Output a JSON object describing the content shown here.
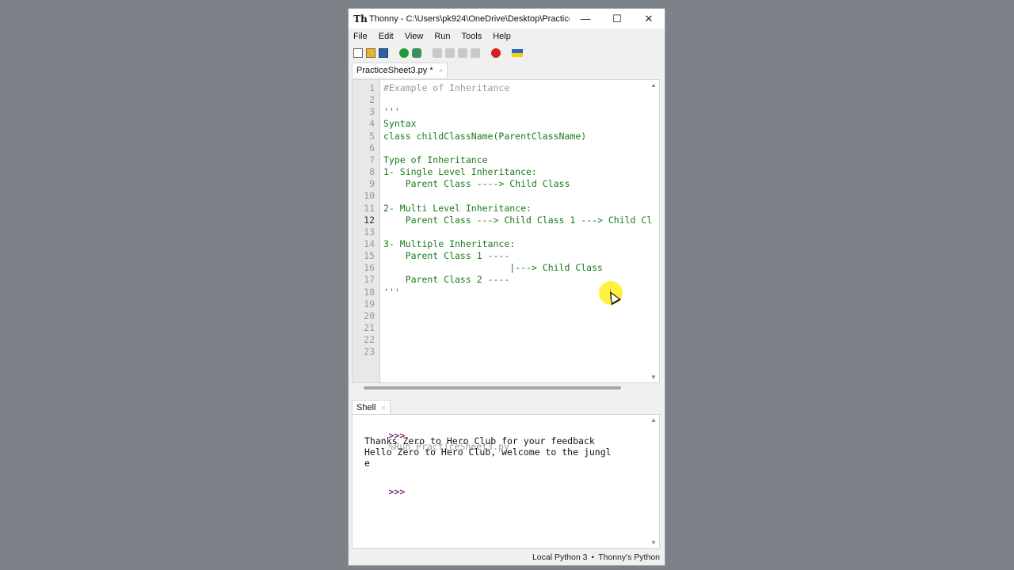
{
  "window": {
    "app_icon": "Th",
    "title": "Thonny  -  C:\\Users\\pk924\\OneDrive\\Desktop\\Practice...",
    "minimize": "—",
    "maximize": "☐",
    "close": "✕"
  },
  "menu": [
    "File",
    "Edit",
    "View",
    "Run",
    "Tools",
    "Help"
  ],
  "toolbar_icons": [
    "new-file-icon",
    "open-file-icon",
    "save-icon",
    "run-icon",
    "debug-icon",
    "step-over-icon",
    "step-into-icon",
    "step-out-icon",
    "resume-icon",
    "stop-icon",
    "ukraine-flag-icon"
  ],
  "editor": {
    "tab_label": "PracticeSheet3.py *",
    "tab_close": "×",
    "current_line": 12,
    "lines": [
      {
        "n": "1",
        "text": "#Example of Inheritance"
      },
      {
        "n": "2",
        "text": ""
      },
      {
        "n": "3",
        "text": "'''"
      },
      {
        "n": "4",
        "text": "Syntax"
      },
      {
        "n": "5",
        "text": "class childClassName(ParentClassName)"
      },
      {
        "n": "6",
        "text": ""
      },
      {
        "n": "7",
        "text": "Type of Inheritance"
      },
      {
        "n": "8",
        "text": "1- Single Level Inheritance:"
      },
      {
        "n": "9",
        "text": "    Parent Class ----> Child Class"
      },
      {
        "n": "10",
        "text": ""
      },
      {
        "n": "11",
        "text": "2- Multi Level Inheritance:"
      },
      {
        "n": "12",
        "text": "    Parent Class ---> Child Class 1 ---> Child Cl"
      },
      {
        "n": "13",
        "text": ""
      },
      {
        "n": "14",
        "text": "3- Multiple Inheritance:"
      },
      {
        "n": "15",
        "text": "    Parent Class 1 ----"
      },
      {
        "n": "16",
        "text": "                       |---> Child Class"
      },
      {
        "n": "17",
        "text": "    Parent Class 2 ----"
      },
      {
        "n": "18",
        "text": "'''"
      },
      {
        "n": "19",
        "text": ""
      },
      {
        "n": "20",
        "text": ""
      },
      {
        "n": "21",
        "text": ""
      },
      {
        "n": "22",
        "text": ""
      },
      {
        "n": "23",
        "text": ""
      }
    ]
  },
  "shell": {
    "tab_label": "Shell",
    "tab_close": "×",
    "prompt": ">>>",
    "run_command": "%Run PracticeSheet3.py",
    "output": [
      "Thanks Zero to Hero Club for your feedback",
      "Hello Zero to Hero Club, welcome to the jungl",
      "e"
    ]
  },
  "status": {
    "interpreter": "Local Python 3",
    "separator": "•",
    "python_label": "Thonny's Python"
  },
  "scroll_arrows": {
    "up": "▲",
    "down": "▼"
  }
}
